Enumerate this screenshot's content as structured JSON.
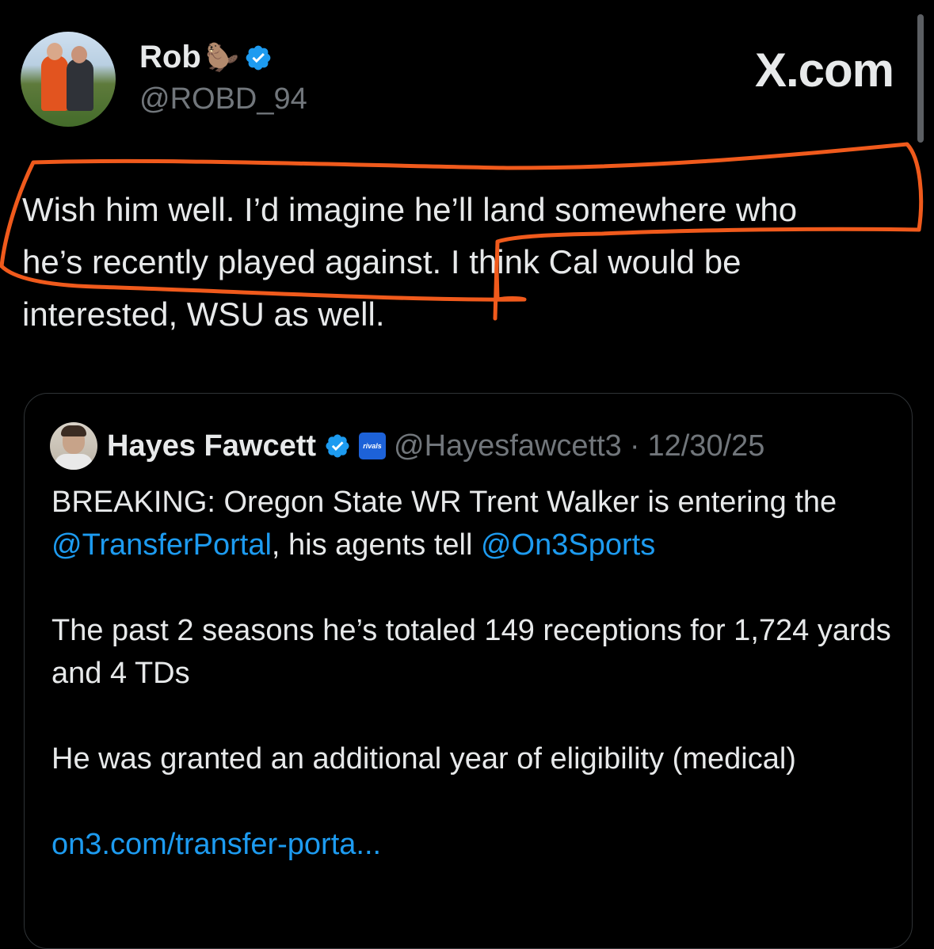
{
  "tweet": {
    "author": {
      "display_name": "Rob",
      "emoji": "🦫",
      "handle": "@ROBD_94",
      "verified": true
    },
    "site_mark": "X.com",
    "text_line1": "Wish him well. I’d imagine he’ll land somewhere who",
    "text_line2": "he’s recently played against. I think Cal would be",
    "text_line3": "interested, WSU as well."
  },
  "quoted": {
    "display_name": "Hayes Fawcett",
    "affiliate_badge": "rivals",
    "handle": "@Hayesfawcett3",
    "separator": "·",
    "date": "12/30/25",
    "p1_pre": "BREAKING: Oregon State WR Trent Walker is entering the ",
    "p1_mention1": "@TransferPortal",
    "p1_mid": ", his agents tell ",
    "p1_mention2": "@On3Sports",
    "p2": "The past 2 seasons he’s totaled 149 receptions for 1,724 yards and 4 TDs",
    "p3": "He was granted an additional year of eligibility (medical)",
    "link": "on3.com/transfer-porta..."
  },
  "colors": {
    "background": "#000000",
    "text": "#e7e9ea",
    "secondary": "#71767b",
    "link": "#1d9bf0",
    "verified": "#1d9bf0",
    "annotation": "#f05a1c"
  }
}
